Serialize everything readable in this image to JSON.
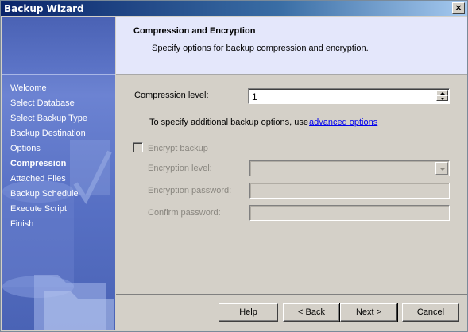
{
  "window": {
    "title": "Backup Wizard",
    "close_glyph": "×"
  },
  "sidebar": {
    "steps": [
      {
        "label": "Welcome"
      },
      {
        "label": "Select Database"
      },
      {
        "label": "Select Backup Type"
      },
      {
        "label": "Backup Destination"
      },
      {
        "label": "Options"
      },
      {
        "label": "Compression",
        "current": true
      },
      {
        "label": "Attached Files"
      },
      {
        "label": "Backup Schedule"
      },
      {
        "label": "Execute Script"
      },
      {
        "label": "Finish"
      }
    ]
  },
  "header": {
    "title": "Compression and Encryption",
    "subtitle": "Specify options for backup compression and encryption."
  },
  "compression": {
    "label": "Compression level:",
    "value": "1"
  },
  "advanced": {
    "text": "To specify additional backup options, use",
    "link": "advanced options"
  },
  "encryption": {
    "checkbox_label": "Encrypt backup",
    "checked": false,
    "level_label": "Encryption level:",
    "level_value": "",
    "password_label": "Encryption password:",
    "confirm_label": "Confirm password:"
  },
  "buttons": {
    "help": "Help",
    "back": "< Back",
    "next": "Next >",
    "cancel": "Cancel"
  },
  "colors": {
    "sidebar": "#5770c4",
    "header_bg": "#e4e7fb",
    "link": "#0000ee",
    "titlebar": "#0a246a"
  }
}
